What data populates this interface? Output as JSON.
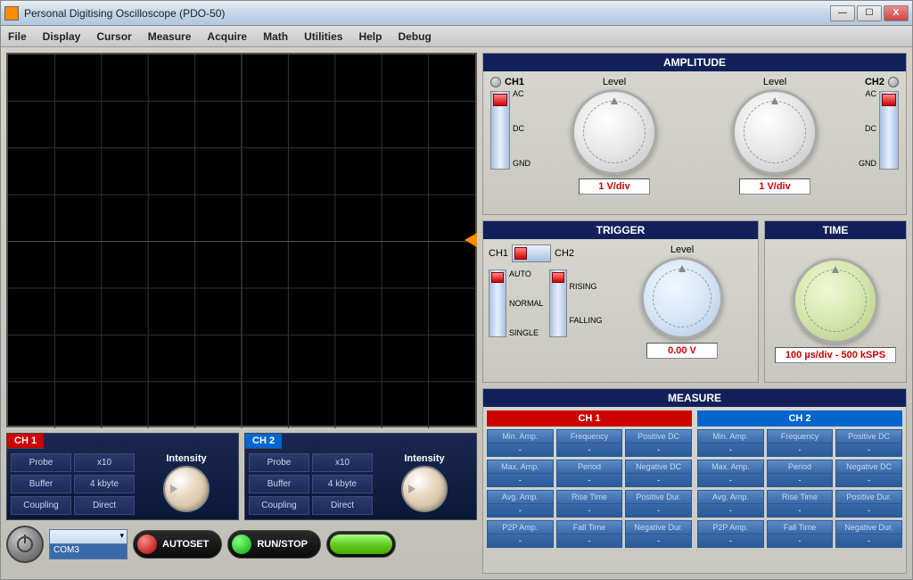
{
  "window": {
    "title": "Personal Digitising Oscilloscope (PDO-50)"
  },
  "menu": [
    "File",
    "Display",
    "Cursor",
    "Measure",
    "Acquire",
    "Math",
    "Utilities",
    "Help",
    "Debug"
  ],
  "ch1": {
    "title": "CH 1",
    "probe_lbl": "Probe",
    "probe_val": "x10",
    "buffer_lbl": "Buffer",
    "buffer_val": "4 kbyte",
    "coupling_lbl": "Coupling",
    "coupling_val": "Direct",
    "intensity": "Intensity"
  },
  "ch2": {
    "title": "CH 2",
    "probe_lbl": "Probe",
    "probe_val": "x10",
    "buffer_lbl": "Buffer",
    "buffer_val": "4 kbyte",
    "coupling_lbl": "Coupling",
    "coupling_val": "Direct",
    "intensity": "Intensity"
  },
  "bottom": {
    "port": "COM3",
    "autoset": "AUTOSET",
    "runstop": "RUN/STOP"
  },
  "amplitude": {
    "title": "AMPLITUDE",
    "ch1": "CH1",
    "ch2": "CH2",
    "level": "Level",
    "ac": "AC",
    "dc": "DC",
    "gnd": "GND",
    "readout1": "1 V/div",
    "readout2": "1 V/div"
  },
  "trigger": {
    "title": "TRIGGER",
    "ch1": "CH1",
    "ch2": "CH2",
    "auto": "AUTO",
    "normal": "NORMAL",
    "single": "SINGLE",
    "rising": "RISING",
    "falling": "FALLING",
    "level": "Level",
    "readout": "0.00 V"
  },
  "time": {
    "title": "TIME",
    "readout": "100 µs/div - 500 kSPS"
  },
  "measure": {
    "title": "MEASURE",
    "ch1_title": "CH 1",
    "ch2_title": "CH 2",
    "labels": [
      "Min. Amp.",
      "Frequency",
      "Positive DC",
      "Max. Amp.",
      "Period",
      "Negative DC",
      "Avg. Amp.",
      "Rise Time",
      "Positive Dur.",
      "P2P Amp.",
      "Fall Time",
      "Negative Dur."
    ],
    "values": [
      "-",
      "-",
      "-",
      "-",
      "-",
      "-",
      "-",
      "-",
      "-",
      "-",
      "-",
      "-"
    ]
  }
}
